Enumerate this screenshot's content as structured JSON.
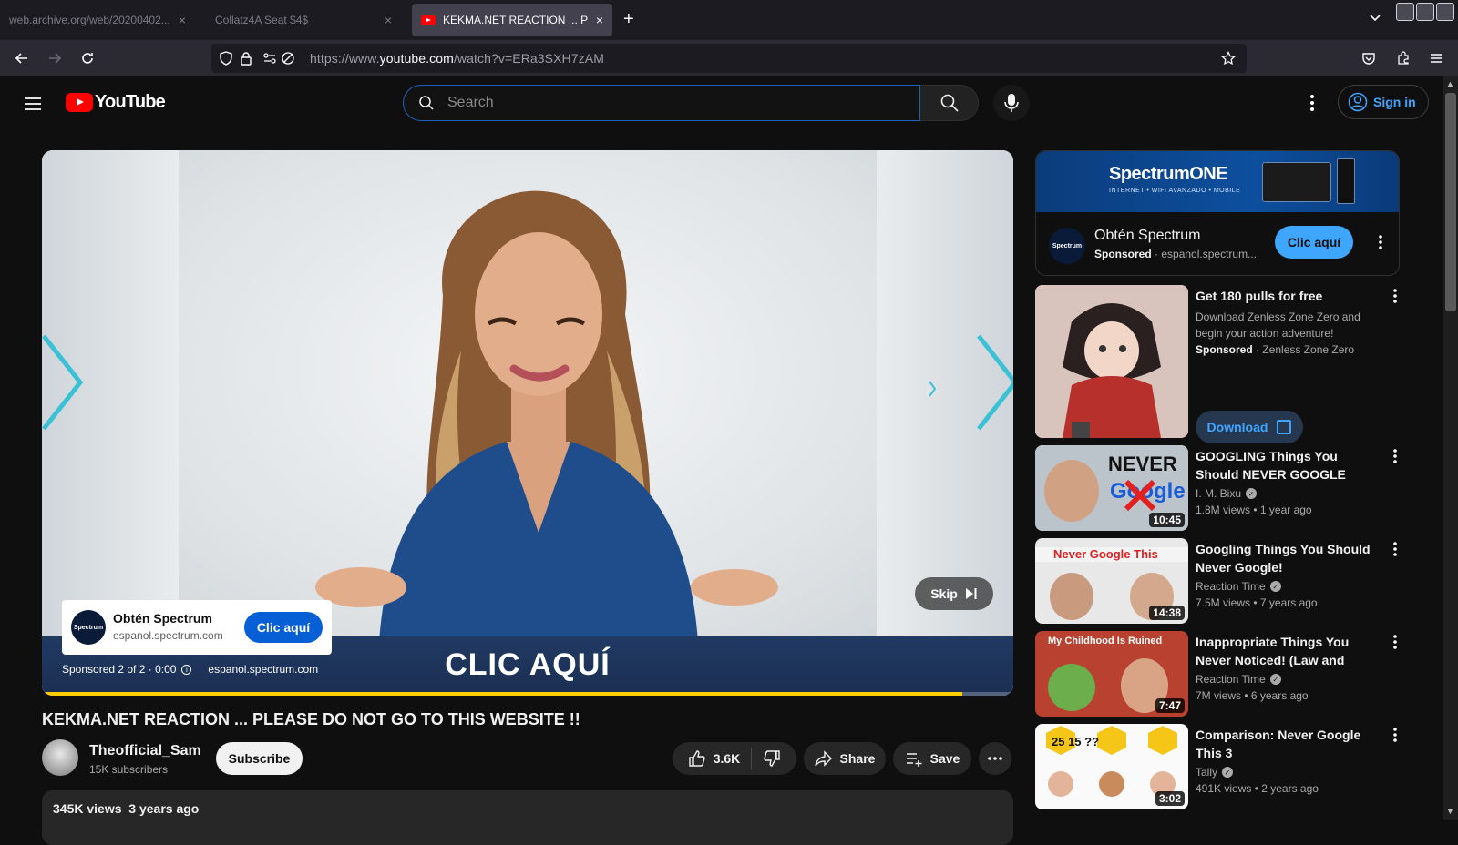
{
  "browser": {
    "tabs": [
      {
        "label": "web.archive.org/web/20200402..."
      },
      {
        "label": "Collatz4A Seat $4$"
      },
      {
        "label": "KEKMA.NET REACTION ... PLEASE"
      }
    ],
    "url": {
      "prefix": "https://www.",
      "host": "youtube.com",
      "path": "/watch?v=ERa3SXH7zAM"
    }
  },
  "header": {
    "logo_text": "YouTube",
    "search_placeholder": "Search",
    "sign_in_label": "Sign in"
  },
  "player": {
    "ad_banner_text": "CLIC AQUÍ",
    "ad_card": {
      "logo_text": "Spectrum",
      "title": "Obtén Spectrum",
      "domain": "espanol.spectrum.com",
      "button": "Clic aquí"
    },
    "ad_meta": {
      "sponsored": "Sponsored 2 of 2 · 0:00",
      "domain": "espanol.spectrum.com"
    },
    "skip_label": "Skip",
    "progress_fraction": 0.947,
    "progress_color": "#ffcc00"
  },
  "video": {
    "title": "KEKMA.NET REACTION ... PLEASE DO NOT GO TO THIS WEBSITE !!",
    "channel_name": "Theofficial_Sam",
    "subscribers": "15K subscribers",
    "subscribe_label": "Subscribe",
    "likes": "3.6K",
    "share_label": "Share",
    "save_label": "Save",
    "views": "345K views",
    "age": "3 years ago"
  },
  "sidebar": {
    "ad": {
      "brand": "SpectrumONE",
      "brand_sub": "INTERNET • WIFI AVANZADO • MOBILE",
      "logo_text": "Spectrum",
      "title": "Obtén Spectrum",
      "sponsored_label": "Sponsored",
      "domain": "· espanol.spectrum...",
      "button": "Clic aquí"
    },
    "promo": {
      "title": "Get 180 pulls for free",
      "description": "Download Zenless Zone Zero and begin your action adventure!",
      "sponsored_label": "Sponsored",
      "advertiser": "· Zenless Zone Zero",
      "button": "Download"
    },
    "recommendations": [
      {
        "title": "GOOGLING Things You Should NEVER GOOGLE (Worst...",
        "channel": "I. M. Bixu",
        "meta": "1.8M views • 1 year ago",
        "duration": "10:45",
        "thumb_text": "NEVER"
      },
      {
        "title": "Googling Things You Should Never Google!",
        "channel": "Reaction Time",
        "meta": "7.5M views • 7 years ago",
        "duration": "14:38",
        "thumb_text": "Never Google This"
      },
      {
        "title": "Inappropriate Things You Never Noticed! (Law and Order...",
        "channel": "Reaction Time",
        "meta": "7M views • 6 years ago",
        "duration": "7:47",
        "thumb_text": "My Childhood Is Ruined"
      },
      {
        "title": "Comparison: Never Google This 3",
        "channel": "Tally",
        "meta": "491K views • 2 years ago",
        "duration": "3:02",
        "thumb_text": "25  15  ??"
      }
    ]
  }
}
